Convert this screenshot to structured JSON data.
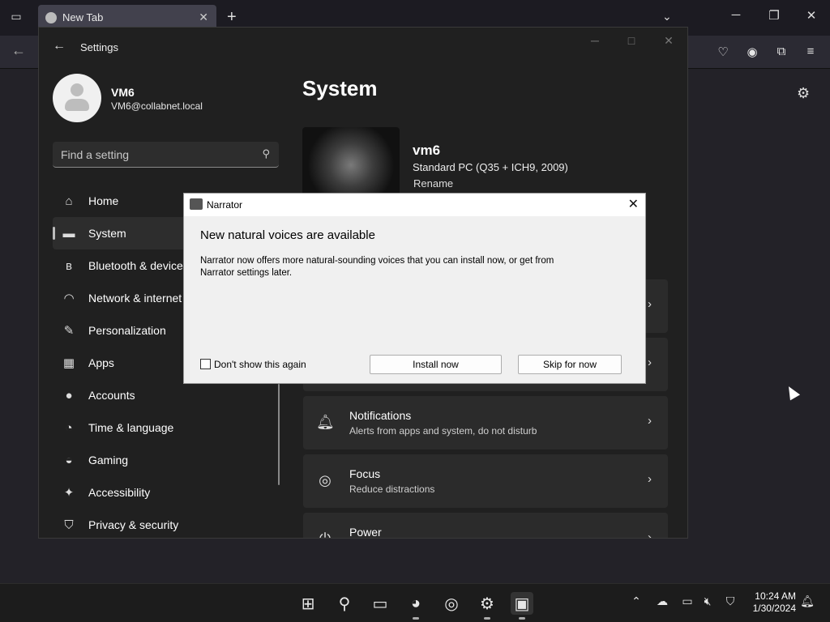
{
  "browser": {
    "tab_title": "New Tab",
    "new_tab": "+",
    "tab_close": "✕"
  },
  "settings": {
    "window_title": "Settings",
    "user": {
      "name": "VM6",
      "email": "VM6@collabnet.local"
    },
    "search": {
      "placeholder": "Find a setting"
    },
    "nav": [
      {
        "label": "Home",
        "icon": "home-icon",
        "selected": false
      },
      {
        "label": "System",
        "icon": "system-icon",
        "selected": true
      },
      {
        "label": "Bluetooth & devices",
        "icon": "bluetooth-icon",
        "selected": false
      },
      {
        "label": "Network & internet",
        "icon": "wifi-icon",
        "selected": false
      },
      {
        "label": "Personalization",
        "icon": "brush-icon",
        "selected": false
      },
      {
        "label": "Apps",
        "icon": "apps-icon",
        "selected": false
      },
      {
        "label": "Accounts",
        "icon": "accounts-icon",
        "selected": false
      },
      {
        "label": "Time & language",
        "icon": "globe-clock-icon",
        "selected": false
      },
      {
        "label": "Gaming",
        "icon": "gamepad-icon",
        "selected": false
      },
      {
        "label": "Accessibility",
        "icon": "accessibility-icon",
        "selected": false
      },
      {
        "label": "Privacy & security",
        "icon": "shield-icon",
        "selected": false
      }
    ],
    "page_title": "System",
    "device": {
      "name": "vm6",
      "model": "Standard PC (Q35 + ICH9, 2009)",
      "rename": "Rename"
    },
    "cards": [
      {
        "title": "Notifications",
        "subtitle": "Alerts from apps and system, do not disturb",
        "icon": "bell-icon"
      },
      {
        "title": "Focus",
        "subtitle": "Reduce distractions",
        "icon": "focus-icon"
      },
      {
        "title": "Power",
        "subtitle": "",
        "icon": "power-icon"
      }
    ]
  },
  "narrator": {
    "title": "Narrator",
    "heading": "New natural voices are available",
    "body": "Narrator now offers more natural-sounding voices that you can install now, or get from Narrator settings later.",
    "checkbox_label": "Don't show this again",
    "install_label": "Install now",
    "skip_label": "Skip for now"
  },
  "taskbar": {
    "time": "10:24 AM",
    "date": "1/30/2024"
  }
}
